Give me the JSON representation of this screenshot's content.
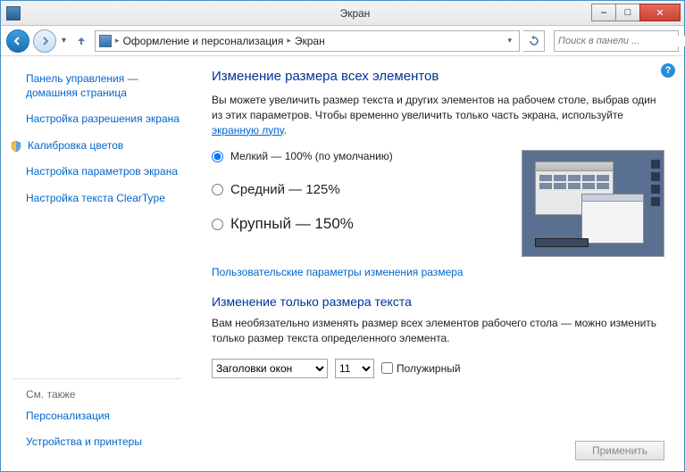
{
  "window": {
    "title": "Экран",
    "min_label": "–",
    "max_label": "□",
    "close_label": "✕"
  },
  "nav": {
    "breadcrumb1": "Оформление и персонализация",
    "breadcrumb2": "Экран",
    "search_placeholder": "Поиск в панели ..."
  },
  "sidebar": {
    "home": "Панель управления — домашняя страница",
    "items": [
      "Настройка разрешения экрана",
      "Калибровка цветов",
      "Настройка параметров экрана",
      "Настройка текста ClearType"
    ],
    "see_also_header": "См. также",
    "see_also": [
      "Персонализация",
      "Устройства и принтеры"
    ]
  },
  "main": {
    "h1": "Изменение размера всех элементов",
    "desc_pre": "Вы можете увеличить размер текста и других элементов на рабочем столе, выбрав один из этих параметров. Чтобы временно увеличить только часть экрана, используйте ",
    "desc_link": "экранную лупу",
    "desc_post": ".",
    "radios": [
      "Мелкий — 100% (по умолчанию)",
      "Средний — 125%",
      "Крупный — 150%"
    ],
    "custom_link": "Пользовательские параметры изменения размера",
    "h2": "Изменение только размера текста",
    "desc2": "Вам необязательно изменять размер всех элементов рабочего стола — можно изменить только размер текста определенного элемента.",
    "element_select": "Заголовки окон",
    "size_select": "11",
    "bold_label": "Полужирный",
    "apply": "Применить"
  }
}
